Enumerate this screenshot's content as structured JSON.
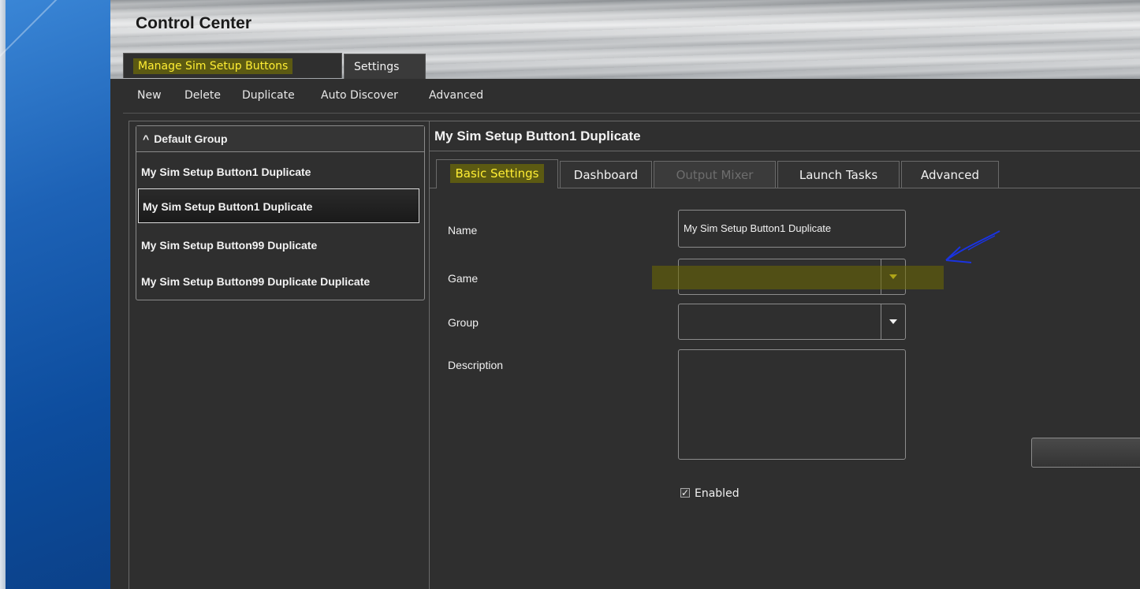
{
  "window": {
    "title": "Control Center"
  },
  "top_tabs": [
    {
      "label": "Manage Sim Setup Buttons",
      "active": true
    },
    {
      "label": "Settings",
      "active": false
    }
  ],
  "toolbar": [
    "New",
    "Delete",
    "Duplicate",
    "Auto Discover",
    "Advanced"
  ],
  "group": {
    "header": "Default Group",
    "items": [
      {
        "label": "My Sim Setup Button1 Duplicate",
        "selected": false
      },
      {
        "label": "My Sim Setup Button1 Duplicate",
        "selected": true
      },
      {
        "label": "My Sim Setup Button99 Duplicate",
        "selected": false
      },
      {
        "label": "My Sim Setup Button99 Duplicate Duplicate",
        "selected": false
      }
    ]
  },
  "detail": {
    "title": "My Sim Setup Button1 Duplicate",
    "tabs": [
      {
        "label": "Basic Settings",
        "state": "active"
      },
      {
        "label": "Dashboard",
        "state": "normal"
      },
      {
        "label": "Output Mixer",
        "state": "disabled"
      },
      {
        "label": "Launch Tasks",
        "state": "normal"
      },
      {
        "label": "Advanced",
        "state": "normal"
      }
    ],
    "form": {
      "name_label": "Name",
      "name_value": "My Sim Setup Button1 Duplicate",
      "game_label": "Game",
      "game_value": "",
      "group_label": "Group",
      "group_value": "",
      "description_label": "Description",
      "description_value": "",
      "enabled_label": "Enabled",
      "enabled": true
    }
  },
  "icons": {
    "collapse": "chevron-up-icon",
    "dropdown": "chevron-down-icon",
    "check": "check-icon"
  },
  "colors": {
    "accent_text": "#ffee33",
    "highlight": "#5c5a12",
    "panel_bg": "#2f2f2f",
    "annotation": "#1a33e0"
  }
}
